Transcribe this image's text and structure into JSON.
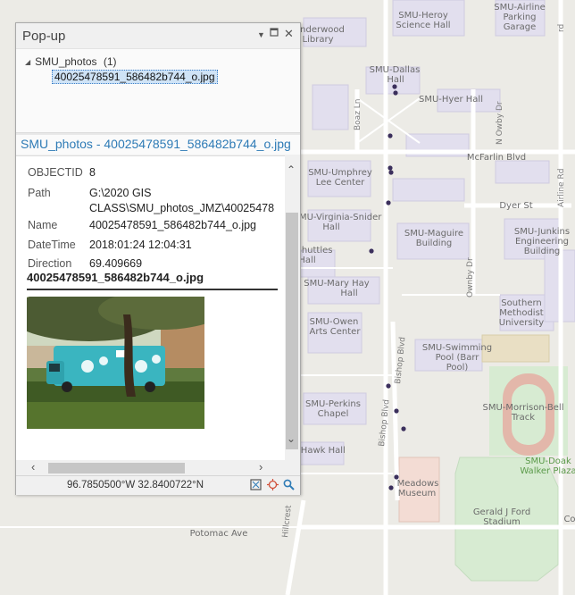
{
  "map": {
    "labels": {
      "heroy": [
        "SMU-Heroy",
        "Science Hall"
      ],
      "airline": [
        "SMU-Airline",
        "Parking",
        "Garage"
      ],
      "underwood": [
        "nderwood",
        "Library"
      ],
      "dallas": [
        "SMU-Dallas",
        "Hall"
      ],
      "hyer": "SMU-Hyer Hall",
      "mcfarlin": "McFarlin Blvd",
      "umphrey": [
        "SMU-Umphrey",
        "Lee Center"
      ],
      "dyer": "Dyer St",
      "virginia": [
        "SMU-Virginia-Snider",
        "Hall"
      ],
      "maguire": [
        "SMU-Maguire",
        "Building"
      ],
      "junkins": [
        "SMU-Junkins",
        "Engineering",
        "Building"
      ],
      "shuttles": [
        "Shuttles",
        "Hall"
      ],
      "maryhay": [
        "SMU-Mary Hay",
        "Hall"
      ],
      "methodist": [
        "Southern",
        "Methodist",
        "University"
      ],
      "owen": [
        "SMU-Owen",
        "Arts Center"
      ],
      "swimming": [
        "SMU-Swimming",
        "Pool (Barr",
        "Pool)"
      ],
      "perkins": [
        "SMU-Perkins",
        "Chapel"
      ],
      "morrison": [
        "SMU-Morrison-Bell",
        "Track"
      ],
      "doak": [
        "SMU-Doak",
        "Walker Plaza"
      ],
      "hawk": "-Hawk Hall",
      "meadows": [
        "Meadows",
        "Museum"
      ],
      "ford": [
        "Gerald J Ford",
        "Stadium"
      ],
      "co": "Co",
      "potomac": "Potomac Ave",
      "hillcrest": "Hillcrest",
      "boaz": "Boaz Ln",
      "nowby": "N Owby Dr",
      "ownby": "Ownby Dr",
      "bishop1": "Bishop Blvd",
      "bishop2": "Bishop Blvd",
      "airline_rd": "Airline Rd",
      "rd": "rd"
    }
  },
  "popup": {
    "title": "Pop-up",
    "layer_name": "SMU_photos",
    "layer_count": "(1)",
    "feature_name": "40025478591_586482b744_o.jpg",
    "feature_header": "SMU_photos - 40025478591_586482b744_o.jpg",
    "fields": {
      "objectid": {
        "label": "OBJECTID",
        "value": "8"
      },
      "path": {
        "label": "Path",
        "value": "G:\\2020 GIS\nCLASS\\SMU_photos_JMZ\\40025478"
      },
      "name": {
        "label": "Name",
        "value": "40025478591_586482b744_o.jpg"
      },
      "datetime": {
        "label": "DateTime",
        "value": "2018:01:24 12:04:31"
      },
      "direction": {
        "label": "Direction",
        "value": "69.409669"
      }
    },
    "attachment_name": "40025478591_586482b744_o.jpg",
    "coordinates": "96.7850500°W 32.8400722°N"
  },
  "icons": {
    "dropdown": "chevron-down-icon",
    "restore": "restore-icon",
    "close": "close-icon",
    "zoom_to": "zoom-to-icon",
    "pan_to": "pan-to-icon",
    "search": "search-icon"
  },
  "colors": {
    "link": "#2e7bb6",
    "selection": "#cfe3f6",
    "photo_points": "#3b2f5c"
  }
}
